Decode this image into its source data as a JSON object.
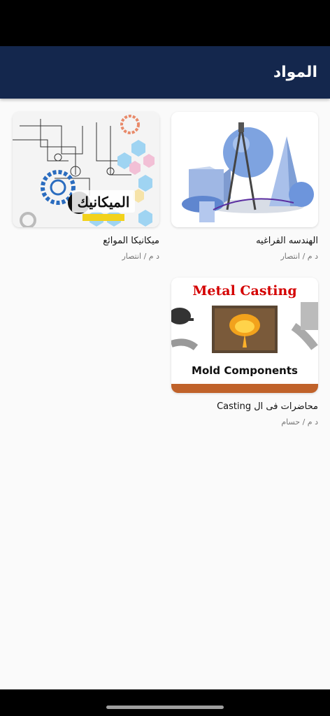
{
  "app_bar": {
    "title": "المواد"
  },
  "courses": [
    {
      "title": "الهندسه الفراغيه",
      "instructor": "د م / انتصار",
      "image_icon": "geometry-shapes-icon"
    },
    {
      "title": "ميكانيكا الموائع",
      "instructor": "د م / انتصار",
      "image_icon": "mechanics-gears-icon",
      "image_text": "الميكانيك"
    },
    {
      "title": "محاضرات فى ال Casting",
      "instructor": "د م / حسام",
      "image_icon": "metal-casting-icon",
      "image_heading": "Metal Casting",
      "image_caption": "Mold Components"
    }
  ],
  "colors": {
    "app_bar": "#14274d",
    "background": "#fafafa",
    "casting_red": "#d40000",
    "casting_bar": "#c0622a"
  }
}
